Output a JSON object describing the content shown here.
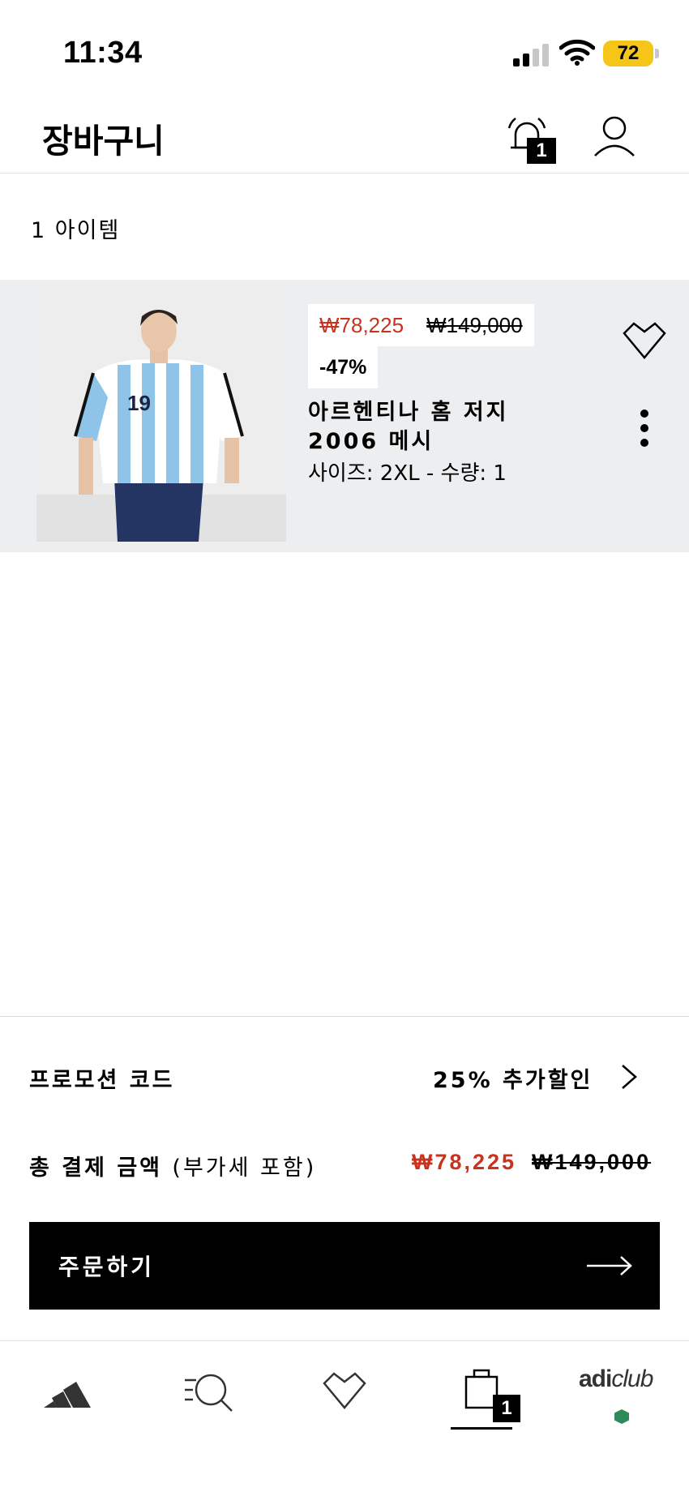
{
  "status_bar": {
    "time": "11:34",
    "battery": "72"
  },
  "header": {
    "title": "장바구니",
    "notification_count": "1"
  },
  "cart": {
    "item_count_label": "1 아이템",
    "items": [
      {
        "sale_price": "₩78,225",
        "original_price": "₩149,000",
        "discount": "-47%",
        "name": "아르헨티나 홈 저지 2006 메시",
        "meta": "사이즈: 2XL - 수량: 1",
        "jersey_number": "19"
      }
    ]
  },
  "summary": {
    "promo_label": "프로모션 코드",
    "promo_value": "25% 추가할인",
    "total_label": "총 결제 금액",
    "total_note": "(부가세 포함)",
    "total_sale": "₩78,225",
    "total_original": "₩149,000",
    "checkout_label": "주문하기"
  },
  "bottom_nav": {
    "bag_count": "1",
    "club_label_bold": "adi",
    "club_label_italic": "club"
  },
  "colors": {
    "accent_sale": "#c8321e",
    "battery": "#f5c518",
    "club_dot": "#2e8a5a"
  }
}
